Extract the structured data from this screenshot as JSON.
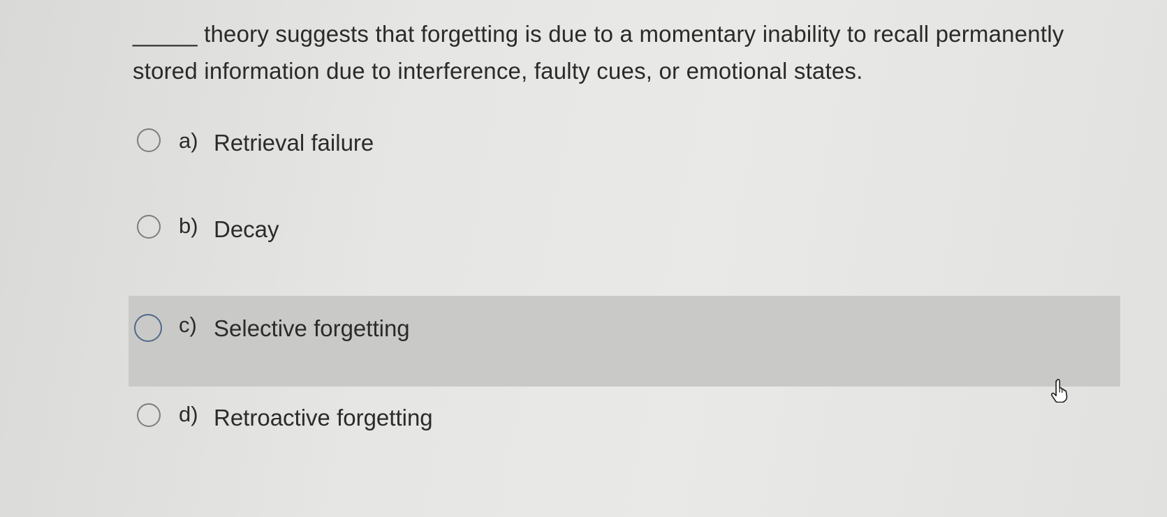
{
  "question": {
    "text": "_____ theory suggests that forgetting is due to a momentary inability to recall permanently stored information due to interference, faulty cues, or emotional states."
  },
  "options": [
    {
      "letter": "a)",
      "label": "Retrieval failure",
      "selected": false,
      "highlighted": false
    },
    {
      "letter": "b)",
      "label": "Decay",
      "selected": false,
      "highlighted": false
    },
    {
      "letter": "c)",
      "label": "Selective forgetting",
      "selected": false,
      "highlighted": true
    },
    {
      "letter": "d)",
      "label": "Retroactive forgetting",
      "selected": false,
      "highlighted": false
    }
  ],
  "cursor": {
    "icon": "hand-pointer-icon"
  },
  "colors": {
    "highlight": "#c9c9c7",
    "radio_border": "#7d7d7d",
    "radio_focus": "#4d6a86"
  }
}
